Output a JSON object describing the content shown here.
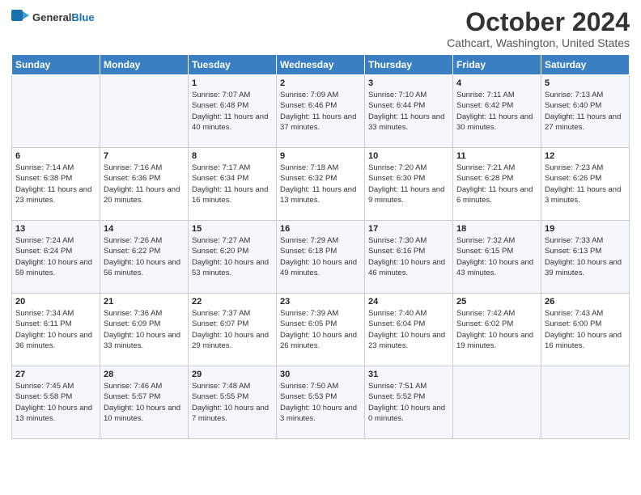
{
  "logo": {
    "text_general": "General",
    "text_blue": "Blue"
  },
  "title": {
    "month_year": "October 2024",
    "location": "Cathcart, Washington, United States"
  },
  "weekdays": [
    "Sunday",
    "Monday",
    "Tuesday",
    "Wednesday",
    "Thursday",
    "Friday",
    "Saturday"
  ],
  "weeks": [
    [
      {
        "day": "",
        "sunrise": "",
        "sunset": "",
        "daylight": ""
      },
      {
        "day": "",
        "sunrise": "",
        "sunset": "",
        "daylight": ""
      },
      {
        "day": "1",
        "sunrise": "Sunrise: 7:07 AM",
        "sunset": "Sunset: 6:48 PM",
        "daylight": "Daylight: 11 hours and 40 minutes."
      },
      {
        "day": "2",
        "sunrise": "Sunrise: 7:09 AM",
        "sunset": "Sunset: 6:46 PM",
        "daylight": "Daylight: 11 hours and 37 minutes."
      },
      {
        "day": "3",
        "sunrise": "Sunrise: 7:10 AM",
        "sunset": "Sunset: 6:44 PM",
        "daylight": "Daylight: 11 hours and 33 minutes."
      },
      {
        "day": "4",
        "sunrise": "Sunrise: 7:11 AM",
        "sunset": "Sunset: 6:42 PM",
        "daylight": "Daylight: 11 hours and 30 minutes."
      },
      {
        "day": "5",
        "sunrise": "Sunrise: 7:13 AM",
        "sunset": "Sunset: 6:40 PM",
        "daylight": "Daylight: 11 hours and 27 minutes."
      }
    ],
    [
      {
        "day": "6",
        "sunrise": "Sunrise: 7:14 AM",
        "sunset": "Sunset: 6:38 PM",
        "daylight": "Daylight: 11 hours and 23 minutes."
      },
      {
        "day": "7",
        "sunrise": "Sunrise: 7:16 AM",
        "sunset": "Sunset: 6:36 PM",
        "daylight": "Daylight: 11 hours and 20 minutes."
      },
      {
        "day": "8",
        "sunrise": "Sunrise: 7:17 AM",
        "sunset": "Sunset: 6:34 PM",
        "daylight": "Daylight: 11 hours and 16 minutes."
      },
      {
        "day": "9",
        "sunrise": "Sunrise: 7:18 AM",
        "sunset": "Sunset: 6:32 PM",
        "daylight": "Daylight: 11 hours and 13 minutes."
      },
      {
        "day": "10",
        "sunrise": "Sunrise: 7:20 AM",
        "sunset": "Sunset: 6:30 PM",
        "daylight": "Daylight: 11 hours and 9 minutes."
      },
      {
        "day": "11",
        "sunrise": "Sunrise: 7:21 AM",
        "sunset": "Sunset: 6:28 PM",
        "daylight": "Daylight: 11 hours and 6 minutes."
      },
      {
        "day": "12",
        "sunrise": "Sunrise: 7:23 AM",
        "sunset": "Sunset: 6:26 PM",
        "daylight": "Daylight: 11 hours and 3 minutes."
      }
    ],
    [
      {
        "day": "13",
        "sunrise": "Sunrise: 7:24 AM",
        "sunset": "Sunset: 6:24 PM",
        "daylight": "Daylight: 10 hours and 59 minutes."
      },
      {
        "day": "14",
        "sunrise": "Sunrise: 7:26 AM",
        "sunset": "Sunset: 6:22 PM",
        "daylight": "Daylight: 10 hours and 56 minutes."
      },
      {
        "day": "15",
        "sunrise": "Sunrise: 7:27 AM",
        "sunset": "Sunset: 6:20 PM",
        "daylight": "Daylight: 10 hours and 53 minutes."
      },
      {
        "day": "16",
        "sunrise": "Sunrise: 7:29 AM",
        "sunset": "Sunset: 6:18 PM",
        "daylight": "Daylight: 10 hours and 49 minutes."
      },
      {
        "day": "17",
        "sunrise": "Sunrise: 7:30 AM",
        "sunset": "Sunset: 6:16 PM",
        "daylight": "Daylight: 10 hours and 46 minutes."
      },
      {
        "day": "18",
        "sunrise": "Sunrise: 7:32 AM",
        "sunset": "Sunset: 6:15 PM",
        "daylight": "Daylight: 10 hours and 43 minutes."
      },
      {
        "day": "19",
        "sunrise": "Sunrise: 7:33 AM",
        "sunset": "Sunset: 6:13 PM",
        "daylight": "Daylight: 10 hours and 39 minutes."
      }
    ],
    [
      {
        "day": "20",
        "sunrise": "Sunrise: 7:34 AM",
        "sunset": "Sunset: 6:11 PM",
        "daylight": "Daylight: 10 hours and 36 minutes."
      },
      {
        "day": "21",
        "sunrise": "Sunrise: 7:36 AM",
        "sunset": "Sunset: 6:09 PM",
        "daylight": "Daylight: 10 hours and 33 minutes."
      },
      {
        "day": "22",
        "sunrise": "Sunrise: 7:37 AM",
        "sunset": "Sunset: 6:07 PM",
        "daylight": "Daylight: 10 hours and 29 minutes."
      },
      {
        "day": "23",
        "sunrise": "Sunrise: 7:39 AM",
        "sunset": "Sunset: 6:05 PM",
        "daylight": "Daylight: 10 hours and 26 minutes."
      },
      {
        "day": "24",
        "sunrise": "Sunrise: 7:40 AM",
        "sunset": "Sunset: 6:04 PM",
        "daylight": "Daylight: 10 hours and 23 minutes."
      },
      {
        "day": "25",
        "sunrise": "Sunrise: 7:42 AM",
        "sunset": "Sunset: 6:02 PM",
        "daylight": "Daylight: 10 hours and 19 minutes."
      },
      {
        "day": "26",
        "sunrise": "Sunrise: 7:43 AM",
        "sunset": "Sunset: 6:00 PM",
        "daylight": "Daylight: 10 hours and 16 minutes."
      }
    ],
    [
      {
        "day": "27",
        "sunrise": "Sunrise: 7:45 AM",
        "sunset": "Sunset: 5:58 PM",
        "daylight": "Daylight: 10 hours and 13 minutes."
      },
      {
        "day": "28",
        "sunrise": "Sunrise: 7:46 AM",
        "sunset": "Sunset: 5:57 PM",
        "daylight": "Daylight: 10 hours and 10 minutes."
      },
      {
        "day": "29",
        "sunrise": "Sunrise: 7:48 AM",
        "sunset": "Sunset: 5:55 PM",
        "daylight": "Daylight: 10 hours and 7 minutes."
      },
      {
        "day": "30",
        "sunrise": "Sunrise: 7:50 AM",
        "sunset": "Sunset: 5:53 PM",
        "daylight": "Daylight: 10 hours and 3 minutes."
      },
      {
        "day": "31",
        "sunrise": "Sunrise: 7:51 AM",
        "sunset": "Sunset: 5:52 PM",
        "daylight": "Daylight: 10 hours and 0 minutes."
      },
      {
        "day": "",
        "sunrise": "",
        "sunset": "",
        "daylight": ""
      },
      {
        "day": "",
        "sunrise": "",
        "sunset": "",
        "daylight": ""
      }
    ]
  ]
}
